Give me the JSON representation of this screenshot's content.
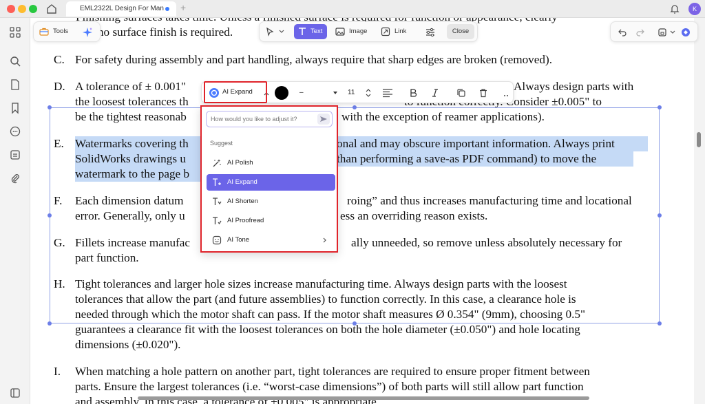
{
  "window": {
    "tab_title": "EML2322L Design For Man",
    "user_initial": "K"
  },
  "toolbar_left": {
    "tools_label": "Tools"
  },
  "edit_toolbar": {
    "text_label": "Text",
    "image_label": "Image",
    "link_label": "Link",
    "close_label": "Close"
  },
  "format_toolbar": {
    "ai_button_label": "AI Expand",
    "font_value": "–",
    "size_value": "11",
    "colors": {
      "text_color": "#000000"
    }
  },
  "ai_menu": {
    "input_placeholder": "How would you like to adjust it?",
    "section_label": "Suggest",
    "items": [
      {
        "label": "AI Polish",
        "icon": "sparkle-wand-icon"
      },
      {
        "label": "AI Expand",
        "icon": "text-expand-icon"
      },
      {
        "label": "AI Shorten",
        "icon": "text-shorten-icon"
      },
      {
        "label": "AI Proofread",
        "icon": "text-proofread-icon"
      },
      {
        "label": "AI Tone",
        "icon": "smile-icon"
      }
    ]
  },
  "document": {
    "top_line1": "Finishing surfaces takes time.  Unless a finished surface is required for function or appearance, clearly",
    "top_line2": "cate no surface finish is required.",
    "c": [
      "C.",
      "For safety during assembly and part handling, always require that sharp edges are broken (removed)."
    ],
    "d": [
      "D.",
      "A tolerance of ± 0.001\"",
      "Always design parts with",
      "the loosest tolerances th",
      "to function correctly.  Consider ±0.005\" to",
      "be the tightest reasonab",
      "with the exception of reamer applications)."
    ],
    "e": [
      "E.",
      "Watermarks covering th",
      "onal and may obscure important information. Always print",
      "SolidWorks drawings u",
      "than performing a save-as PDF command) to move the",
      "watermark to the page b"
    ],
    "f": [
      "F.",
      "Each dimension datum",
      "roing” and thus increases manufacturing time and locational",
      "error. Generally, only u",
      "ess an overriding reason exists."
    ],
    "g": [
      "G.",
      "Fillets increase manufac",
      "ally unneeded, so remove unless absolutely necessary for",
      "part function."
    ],
    "h": [
      "H.",
      "Tight tolerances and larger hole sizes increase manufacturing time.  Always design parts with the loosest",
      "tolerances that allow the part (and future assemblies) to function correctly.  In this case, a clearance hole is",
      "needed through which the motor shaft can pass.  If the motor shaft measures Ø 0.354\" (9mm), choosing 0.5\"",
      "guarantees a clearance fit with the loosest tolerances on both the hole diameter (±0.050\") and hole locating",
      "dimensions (±0.020\")."
    ],
    "i": [
      "I.",
      "When matching a hole pattern on another part, tight tolerances are required to ensure proper fitment between",
      "parts.  Ensure the largest tolerances (i.e. “worst-case dimensions”) of both parts will still allow part function",
      "and assembly.  In this case, a tolerance of ±0.005\" is appropriate."
    ]
  }
}
